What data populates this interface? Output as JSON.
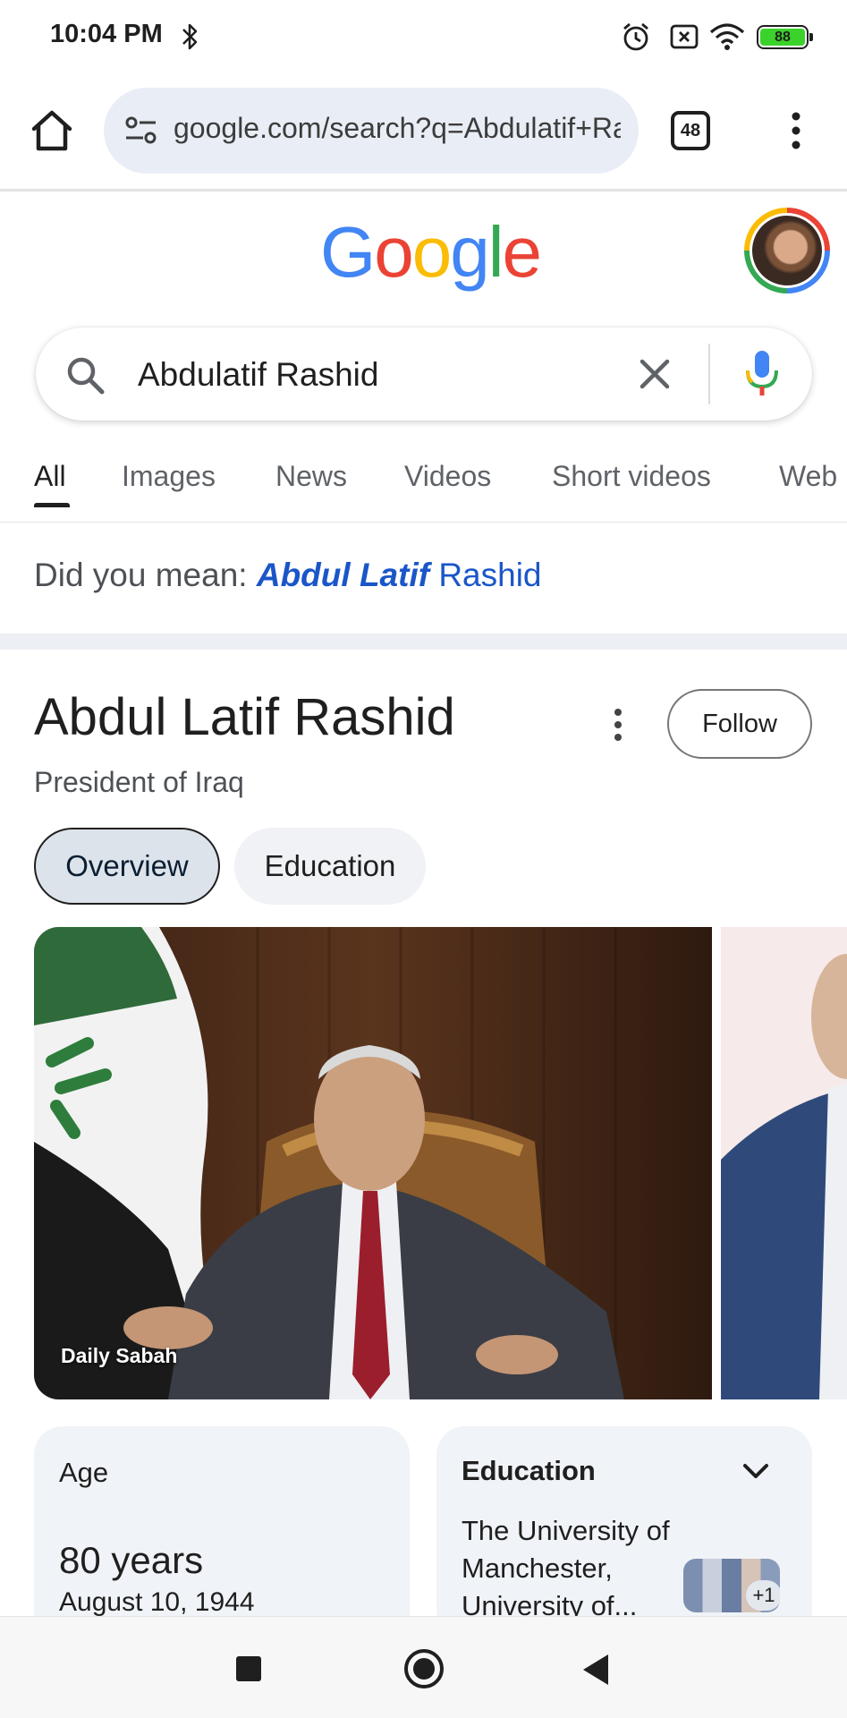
{
  "status_bar": {
    "time": "10:04 PM",
    "battery_level": "88",
    "icons": [
      "bluetooth-icon",
      "alarm-icon",
      "no-sim-icon",
      "wifi-icon",
      "battery-icon"
    ]
  },
  "browser": {
    "url": "google.com/search?q=Abdulatif+Rashid",
    "tab_count": "48"
  },
  "google": {
    "logo": [
      "G",
      "o",
      "o",
      "g",
      "l",
      "e"
    ],
    "logo_colors": [
      "#4285F4",
      "#EA4335",
      "#FBBC05",
      "#4285F4",
      "#34A853",
      "#EA4335"
    ]
  },
  "search": {
    "query": "Abdulatif Rashid"
  },
  "tabs": [
    "All",
    "Images",
    "News",
    "Videos",
    "Short videos",
    "Web"
  ],
  "did_you_mean": {
    "prefix": "Did you mean: ",
    "correction_bold": "Abdul Latif",
    "correction_rest": " Rashid"
  },
  "knowledge_panel": {
    "title": "Abdul Latif Rashid",
    "subtitle": "President of Iraq",
    "follow_label": "Follow",
    "chips": [
      "Overview",
      "Education"
    ],
    "photo_credit": "Daily Sabah",
    "age_card": {
      "label": "Age",
      "value": "80 years",
      "date": "August 10, 1944"
    },
    "education_card": {
      "label": "Education",
      "text": "The University of Manchester, University of...",
      "more_count": "+1"
    }
  },
  "colors": {
    "link_blue": "#1a56c9",
    "chip_active_bg": "#dde3ea",
    "url_bar_bg": "#e9eef6"
  }
}
